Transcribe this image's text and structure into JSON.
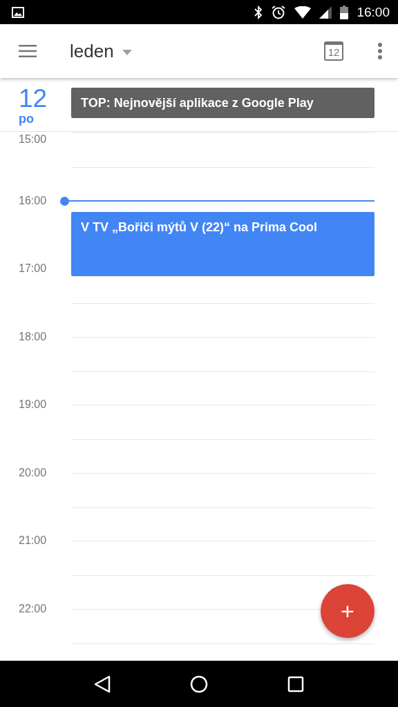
{
  "status_bar": {
    "time": "16:00"
  },
  "app_bar": {
    "title": "leden",
    "today_button": "12"
  },
  "day": {
    "number": "12",
    "weekday": "po"
  },
  "all_day_events": [
    {
      "title": "TOP: Nejnovější aplikace z Google Play",
      "color": "#616161"
    }
  ],
  "hours": [
    {
      "label": "15:00"
    },
    {
      "label": "16:00"
    },
    {
      "label": "17:00"
    },
    {
      "label": "18:00"
    },
    {
      "label": "19:00"
    },
    {
      "label": "20:00"
    },
    {
      "label": "21:00"
    },
    {
      "label": "22:00"
    }
  ],
  "events": [
    {
      "title": "V TV „Bořiči mýtů V (22)“ na Prima Cool",
      "color": "#4285f4"
    }
  ],
  "fab": {
    "label": "+"
  }
}
